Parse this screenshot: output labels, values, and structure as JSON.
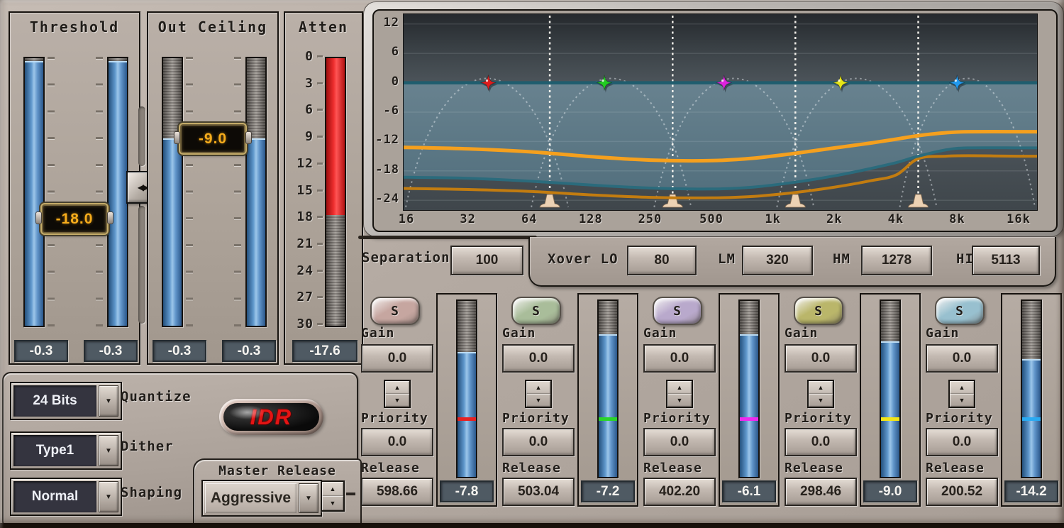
{
  "threshold": {
    "title": "Threshold",
    "tag_value": "-18.0",
    "tag_pct": 60,
    "bar_top_pct": 1,
    "readout_left": "-0.3",
    "readout_right": "-0.3"
  },
  "out_ceiling": {
    "title": "Out Ceiling",
    "tag_value": "-9.0",
    "tag_pct": 30,
    "bar_top_pct": 30,
    "readout_left": "-0.3",
    "readout_right": "-0.3"
  },
  "atten": {
    "title": "Atten",
    "readout": "-17.6",
    "red_pct": 58.7,
    "scale": [
      "0",
      "3",
      "6",
      "9",
      "12",
      "15",
      "18",
      "21",
      "24",
      "27",
      "30"
    ]
  },
  "link_icon": "◀▶",
  "lower_left": {
    "quantize_value": "24 Bits",
    "quantize_label": "Quantize",
    "dither_value": "Type1",
    "dither_label": "Dither",
    "shaping_value": "Normal",
    "shaping_label": "Shaping",
    "idr_text": "IDR"
  },
  "master_release": {
    "label": "Master Release",
    "value": "Aggressive"
  },
  "xover_row": {
    "separation_label": "Separation",
    "separation_value": "100",
    "xover_label": "Xover LO",
    "lo_value": "80",
    "lm_label": "LM",
    "lm_value": "320",
    "hm_label": "HM",
    "hm_value": "1278",
    "hi_label": "HI",
    "hi_value": "5113"
  },
  "bands": [
    {
      "solo_label": "S",
      "solo_color": "#c6a6a0",
      "marker_color": "#e62222",
      "gain_label": "Gain",
      "gain_value": "0.0",
      "priority_label": "Priority",
      "priority_value": "0.0",
      "release_label": "Release",
      "release_value": "598.66",
      "meter_readout": "-7.8",
      "meter_bar_top_pct": 29,
      "meter_tick_pct": 66
    },
    {
      "solo_label": "S",
      "solo_color": "#a9bd9a",
      "marker_color": "#2ad42a",
      "gain_label": "Gain",
      "gain_value": "0.0",
      "priority_label": "Priority",
      "priority_value": "0.0",
      "release_label": "Release",
      "release_value": "503.04",
      "meter_readout": "-7.2",
      "meter_bar_top_pct": 19,
      "meter_tick_pct": 66
    },
    {
      "solo_label": "S",
      "solo_color": "#b9a9cc",
      "marker_color": "#ee2aee",
      "gain_label": "Gain",
      "gain_value": "0.0",
      "priority_label": "Priority",
      "priority_value": "0.0",
      "release_label": "Release",
      "release_value": "402.20",
      "meter_readout": "-6.1",
      "meter_bar_top_pct": 19,
      "meter_tick_pct": 66
    },
    {
      "solo_label": "S",
      "solo_color": "#bab66a",
      "marker_color": "#f2e418",
      "gain_label": "Gain",
      "gain_value": "0.0",
      "priority_label": "Priority",
      "priority_value": "0.0",
      "release_label": "Release",
      "release_value": "298.46",
      "meter_readout": "-9.0",
      "meter_bar_top_pct": 23,
      "meter_tick_pct": 66
    },
    {
      "solo_label": "S",
      "solo_color": "#98c0cf",
      "marker_color": "#2aaaf2",
      "gain_label": "Gain",
      "gain_value": "0.0",
      "priority_label": "Priority",
      "priority_value": "0.0",
      "release_label": "Release",
      "release_value": "200.52",
      "meter_readout": "-14.2",
      "meter_bar_top_pct": 33,
      "meter_tick_pct": 66
    }
  ],
  "chart_data": {
    "type": "line",
    "x_scale": "log2",
    "x_range_hz": [
      16,
      16000
    ],
    "ylim": [
      -26,
      14
    ],
    "yticks": [
      12,
      6,
      0,
      -6,
      -12,
      -18,
      -24
    ],
    "xticks": [
      {
        "hz": 16,
        "label": "16"
      },
      {
        "hz": 32,
        "label": "32"
      },
      {
        "hz": 64,
        "label": "64"
      },
      {
        "hz": 128,
        "label": "128"
      },
      {
        "hz": 250,
        "label": "250"
      },
      {
        "hz": 500,
        "label": "500"
      },
      {
        "hz": 1000,
        "label": "1k"
      },
      {
        "hz": 2000,
        "label": "2k"
      },
      {
        "hz": 4000,
        "label": "4k"
      },
      {
        "hz": 8000,
        "label": "8k"
      },
      {
        "hz": 16000,
        "label": "16k"
      }
    ],
    "zero_line_db": 0,
    "zero_line_color": "#1f5d6e",
    "crossovers_hz": [
      80,
      320,
      1278,
      5113
    ],
    "band_markers": [
      {
        "hz": 40,
        "db": 0,
        "color": "#e01c1c",
        "name": "low-band-marker"
      },
      {
        "hz": 148,
        "db": 0,
        "color": "#22cc22",
        "name": "low-mid-band-marker"
      },
      {
        "hz": 571,
        "db": 0,
        "color": "#dd22dd",
        "name": "mid-band-marker"
      },
      {
        "hz": 2128,
        "db": 0,
        "color": "#e6e616",
        "name": "high-mid-band-marker"
      },
      {
        "hz": 7930,
        "db": 0,
        "color": "#2299ee",
        "name": "high-band-marker"
      }
    ],
    "region": {
      "top_db": 0,
      "follows": "limit-curve",
      "color_top": "#68828f",
      "color_bottom": "#53707e"
    },
    "series": [
      {
        "name": "floor-curve",
        "color": "#c27c10",
        "width": 4,
        "points": [
          [
            16,
            -21.6
          ],
          [
            32,
            -21.8
          ],
          [
            64,
            -22.2
          ],
          [
            128,
            -22.9
          ],
          [
            250,
            -23.4
          ],
          [
            500,
            -23.5
          ],
          [
            800,
            -23.2
          ],
          [
            1278,
            -22.4
          ],
          [
            2000,
            -21.3
          ],
          [
            3000,
            -20.0
          ],
          [
            4000,
            -18.8
          ],
          [
            5113,
            -15.5
          ],
          [
            7000,
            -15.0
          ],
          [
            9000,
            -14.9
          ],
          [
            16000,
            -15.0
          ]
        ]
      },
      {
        "name": "limit-curve",
        "color": "#2b6b7c",
        "width": 4,
        "points": [
          [
            16,
            -19.3
          ],
          [
            32,
            -19.5
          ],
          [
            64,
            -20.1
          ],
          [
            128,
            -20.9
          ],
          [
            250,
            -21.5
          ],
          [
            500,
            -21.7
          ],
          [
            800,
            -21.3
          ],
          [
            1278,
            -20.3
          ],
          [
            2000,
            -19.0
          ],
          [
            3000,
            -17.5
          ],
          [
            4000,
            -16.3
          ],
          [
            5113,
            -15.0
          ],
          [
            7000,
            -13.7
          ],
          [
            9000,
            -13.3
          ],
          [
            16000,
            -13.3
          ]
        ]
      },
      {
        "name": "output-curve",
        "color": "#f5a01e",
        "width": 5,
        "points": [
          [
            16,
            -13.2
          ],
          [
            32,
            -13.5
          ],
          [
            64,
            -14.1
          ],
          [
            128,
            -15.1
          ],
          [
            250,
            -15.8
          ],
          [
            500,
            -15.9
          ],
          [
            800,
            -15.4
          ],
          [
            1278,
            -14.4
          ],
          [
            2000,
            -13.3
          ],
          [
            3000,
            -12.3
          ],
          [
            4000,
            -11.5
          ],
          [
            5113,
            -10.8
          ],
          [
            7000,
            -10.2
          ],
          [
            9000,
            -10.0
          ],
          [
            16000,
            -10.0
          ]
        ]
      }
    ]
  }
}
